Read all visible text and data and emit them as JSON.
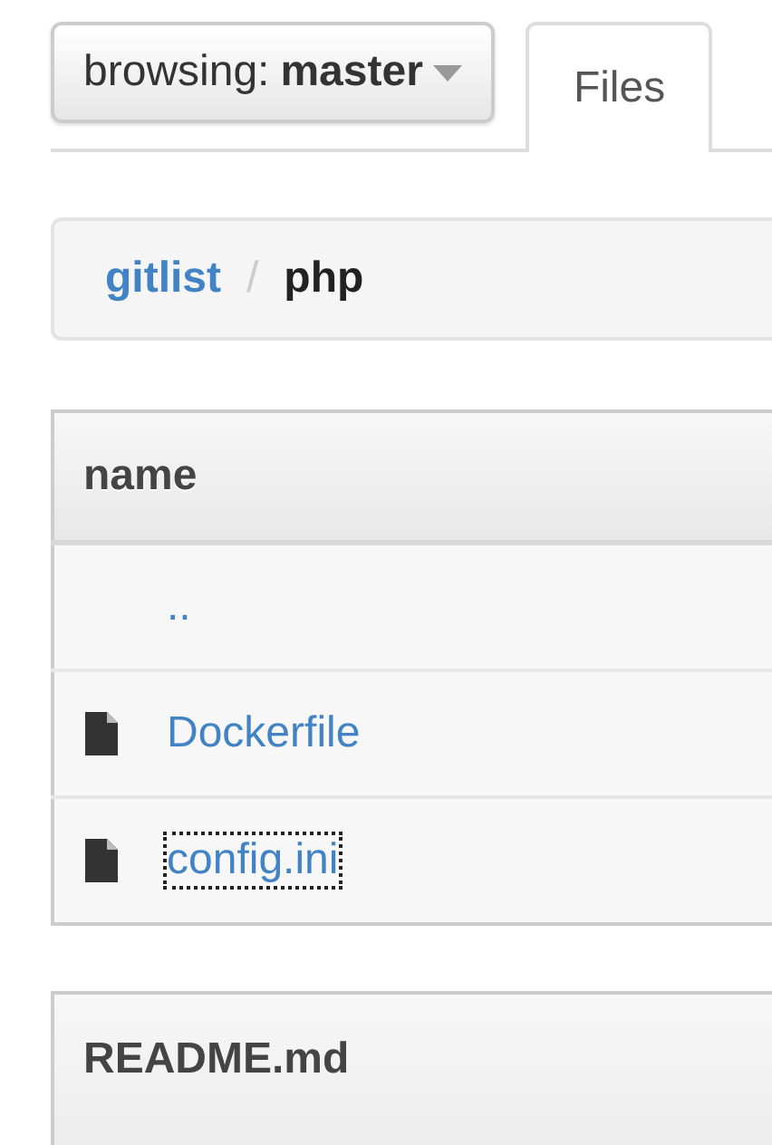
{
  "branch_selector": {
    "label": "browsing:",
    "branch": "master"
  },
  "tabs": [
    {
      "label": "Files",
      "selected": true
    }
  ],
  "breadcrumb": [
    {
      "label": "gitlist",
      "kind": "link"
    },
    {
      "label": "/",
      "kind": "separator"
    },
    {
      "label": "php",
      "kind": "current"
    }
  ],
  "file_table": {
    "columns": [
      "name"
    ],
    "rows": [
      {
        "name": "..",
        "kind": "parent",
        "focused": false
      },
      {
        "name": "Dockerfile",
        "kind": "file",
        "focused": false
      },
      {
        "name": "config.ini",
        "kind": "file",
        "focused": true
      }
    ]
  },
  "readme": {
    "title": "README.md"
  }
}
